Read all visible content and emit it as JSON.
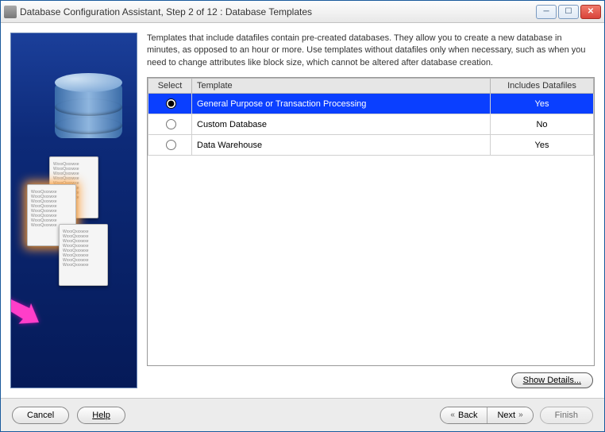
{
  "window": {
    "title": "Database Configuration Assistant, Step 2 of 12 : Database Templates"
  },
  "description": "Templates that include datafiles contain pre-created databases. They allow you to create a new database in minutes, as opposed to an hour or more. Use templates without datafiles only when necessary, such as when you need to change attributes like block size, which cannot be altered after database creation.",
  "table": {
    "headers": {
      "select": "Select",
      "template": "Template",
      "includes": "Includes Datafiles"
    },
    "rows": [
      {
        "template": "General Purpose or Transaction Processing",
        "includes": "Yes",
        "selected": true
      },
      {
        "template": "Custom Database",
        "includes": "No",
        "selected": false
      },
      {
        "template": "Data Warehouse",
        "includes": "Yes",
        "selected": false
      }
    ]
  },
  "buttons": {
    "show_details": "Show Details...",
    "cancel": "Cancel",
    "help": "Help",
    "back": "Back",
    "next": "Next",
    "finish": "Finish"
  }
}
